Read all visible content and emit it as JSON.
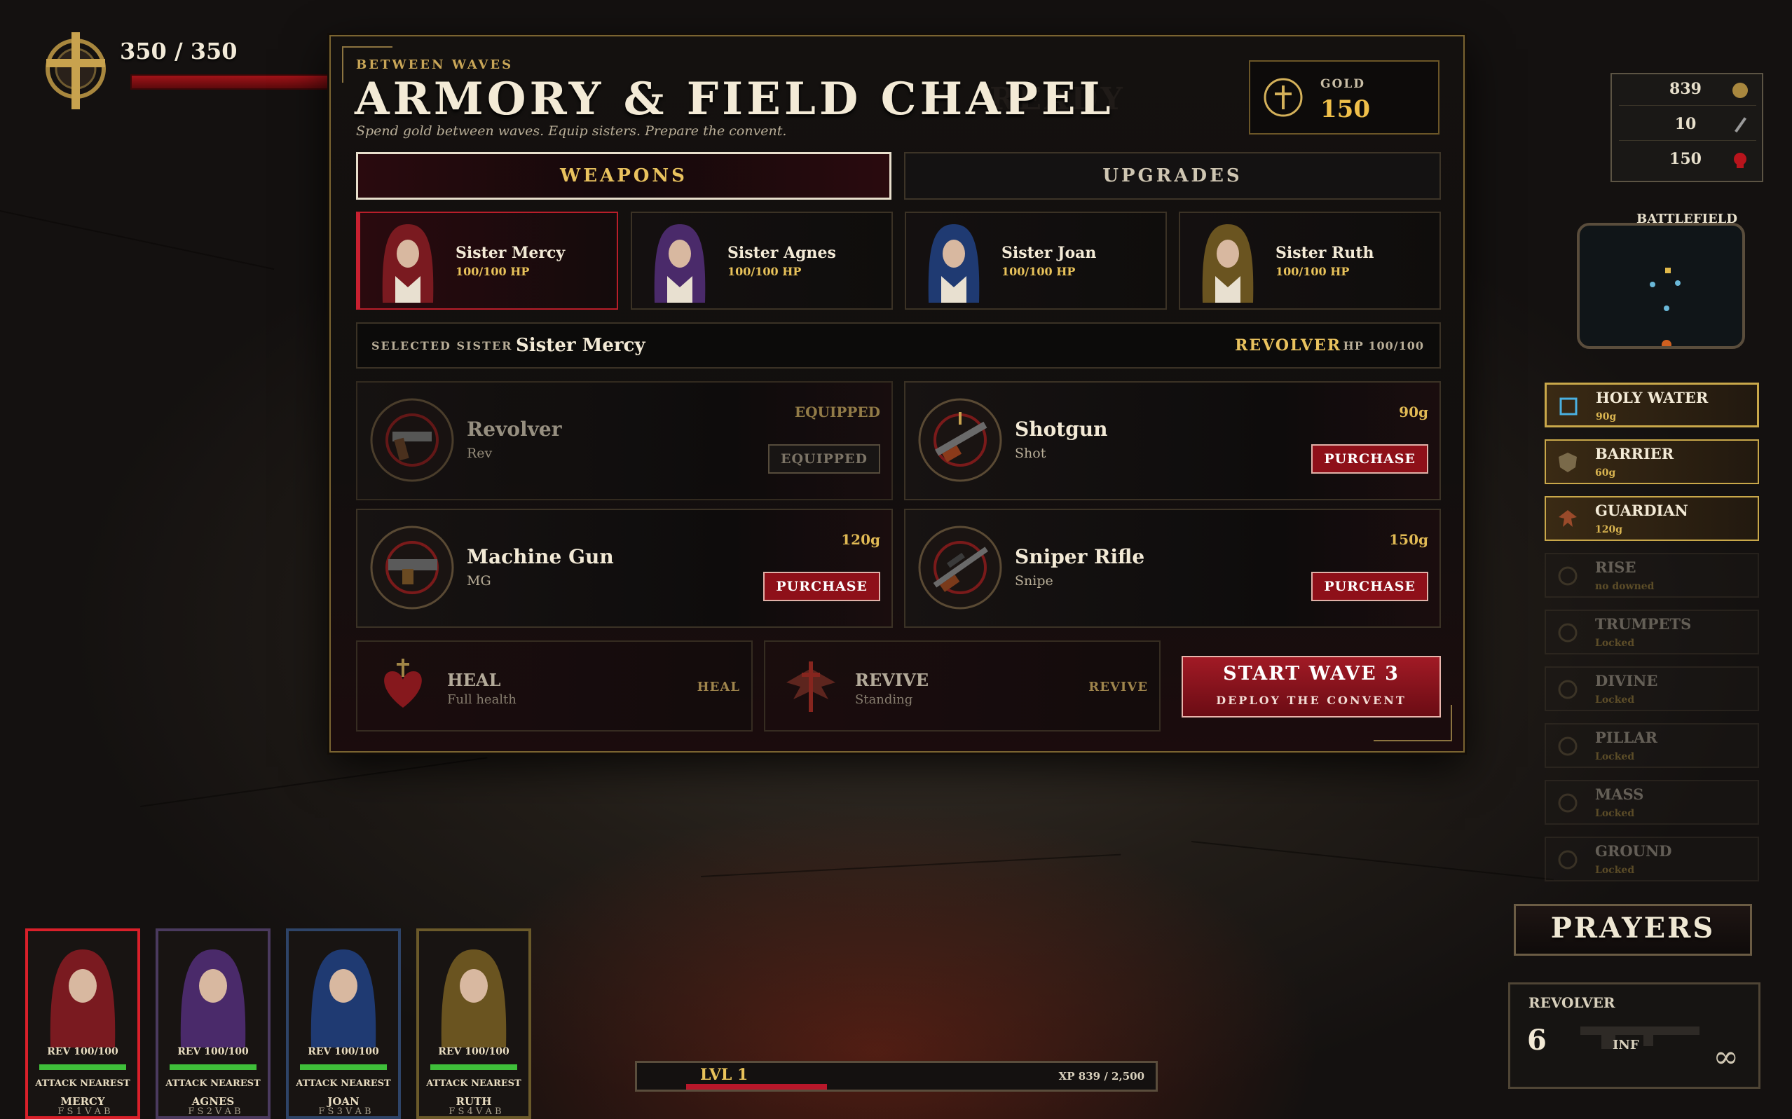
{
  "hud": {
    "health": "350 / 350",
    "stats": [
      {
        "value": "839",
        "icon": "coin-icon"
      },
      {
        "value": "10",
        "icon": "sword-icon"
      },
      {
        "value": "150",
        "icon": "skull-icon"
      }
    ],
    "battlefield_label": "BATTLEFIELD",
    "prayers_label": "PRAYERS",
    "prayers": [
      {
        "name": "HOLY WATER",
        "sub": "90g",
        "state": "active"
      },
      {
        "name": "BARRIER",
        "sub": "60g",
        "state": "active"
      },
      {
        "name": "GUARDIAN",
        "sub": "120g",
        "state": "active"
      },
      {
        "name": "RISE",
        "sub": "no downed",
        "state": "locked"
      },
      {
        "name": "TRUMPETS",
        "sub": "Locked",
        "state": "locked"
      },
      {
        "name": "DIVINE",
        "sub": "Locked",
        "state": "locked"
      },
      {
        "name": "PILLAR",
        "sub": "Locked",
        "state": "locked"
      },
      {
        "name": "MASS",
        "sub": "Locked",
        "state": "locked"
      },
      {
        "name": "GROUND",
        "sub": "Locked",
        "state": "locked"
      }
    ],
    "weapon_panel": {
      "name": "REVOLVER",
      "ammo": "6",
      "reserve": "INF",
      "infinity": "∞"
    },
    "xp": {
      "level": "LVL 1",
      "text": "XP 839 / 2,500",
      "progress": 0.3356
    },
    "squad": [
      {
        "hp": "REV 100/100",
        "mode": "ATTACK NEAREST",
        "name": "MERCY",
        "keys": "F S 1 V A B",
        "color": "#b3202a",
        "selected": true
      },
      {
        "hp": "REV 100/100",
        "mode": "ATTACK NEAREST",
        "name": "AGNES",
        "keys": "F S 2 V A B",
        "color": "#6a3a9a",
        "selected": false
      },
      {
        "hp": "REV 100/100",
        "mode": "ATTACK NEAREST",
        "name": "JOAN",
        "keys": "F S 3 V A B",
        "color": "#2f5a9e",
        "selected": false
      },
      {
        "hp": "REV 100/100",
        "mode": "ATTACK NEAREST",
        "name": "RUTH",
        "keys": "F S 4 V A B",
        "color": "#a8872a",
        "selected": false
      }
    ]
  },
  "modal": {
    "eyebrow": "BETWEEN WAVES",
    "title": "ARMORY & FIELD CHAPEL",
    "ghost_text": "READY",
    "subtitle": "Spend gold between waves. Equip sisters. Prepare the convent.",
    "gold_label": "GOLD",
    "gold_value": "150",
    "tabs": [
      "WEAPONS",
      "UPGRADES"
    ],
    "sisters": [
      {
        "name": "Sister Mercy",
        "hp": "100/100 HP",
        "veil": "#7a1a20"
      },
      {
        "name": "Sister Agnes",
        "hp": "100/100 HP",
        "veil": "#4a2a6a"
      },
      {
        "name": "Sister Joan",
        "hp": "100/100 HP",
        "veil": "#1f3a72"
      },
      {
        "name": "Sister Ruth",
        "hp": "100/100 HP",
        "veil": "#6a5420"
      }
    ],
    "selected": {
      "label": "SELECTED SISTER",
      "name": "Sister Mercy",
      "weapon": "REVOLVER",
      "hp": "HP 100/100"
    },
    "weapons": [
      {
        "name": "Revolver",
        "short": "Rev",
        "price": "EQUIPPED",
        "button": "EQUIPPED",
        "owned": true
      },
      {
        "name": "Shotgun",
        "short": "Shot",
        "price": "90g",
        "button": "PURCHASE",
        "owned": false
      },
      {
        "name": "Machine Gun",
        "short": "MG",
        "price": "120g",
        "button": "PURCHASE",
        "owned": false
      },
      {
        "name": "Sniper Rifle",
        "short": "Snipe",
        "price": "150g",
        "button": "PURCHASE",
        "owned": false
      }
    ],
    "utilities": [
      {
        "name": "HEAL",
        "sub": "Full health",
        "tag": "HEAL",
        "icon": "heart-icon"
      },
      {
        "name": "REVIVE",
        "sub": "Standing",
        "tag": "REVIVE",
        "icon": "winged-cross-icon"
      }
    ],
    "start": {
      "label": "START WAVE 3",
      "sub": "DEPLOY THE CONVENT"
    }
  }
}
